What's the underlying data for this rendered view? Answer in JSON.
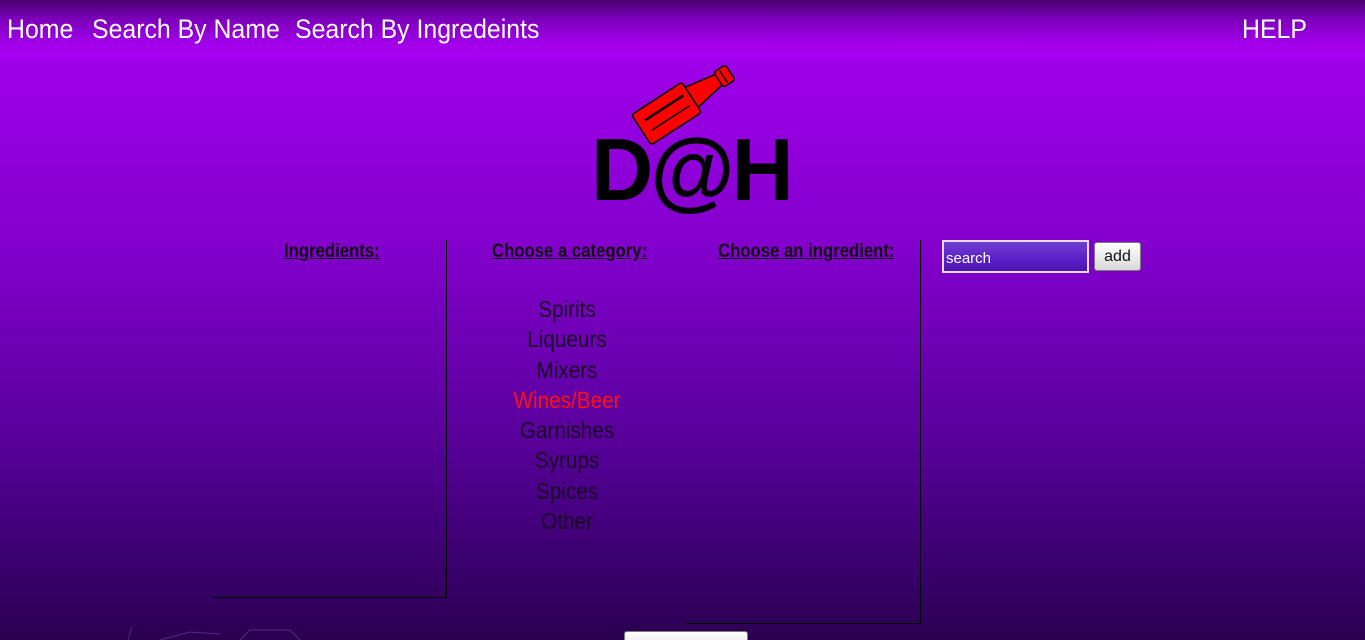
{
  "nav": {
    "home": "Home",
    "search_by_name": "Search By Name",
    "search_by_ingredients": "Search By Ingredeints",
    "help": "HELP"
  },
  "logo": {
    "text": "D@H",
    "icon": "bottle-icon",
    "text_color": "#000000",
    "bottle_color": "#ff0000"
  },
  "columns": {
    "ingredients_heading": "Ingredients:",
    "category_heading": "Choose a category:",
    "ingredient_heading": "Choose an ingredient:"
  },
  "categories": [
    {
      "label": "Spirits",
      "active": false
    },
    {
      "label": "Liqueurs",
      "active": false
    },
    {
      "label": "Mixers",
      "active": false
    },
    {
      "label": "Wines/Beer",
      "active": true
    },
    {
      "label": "Garnishes",
      "active": false
    },
    {
      "label": "Syrups",
      "active": false
    },
    {
      "label": "Spices",
      "active": false
    },
    {
      "label": "Other",
      "active": false
    }
  ],
  "search": {
    "placeholder": "search",
    "value": ""
  },
  "add_button_label": "add",
  "colors": {
    "background_top": "#a800f2",
    "background_bottom": "#2a0050",
    "active_category": "#ff1010",
    "nav_text": "#ffffff"
  }
}
